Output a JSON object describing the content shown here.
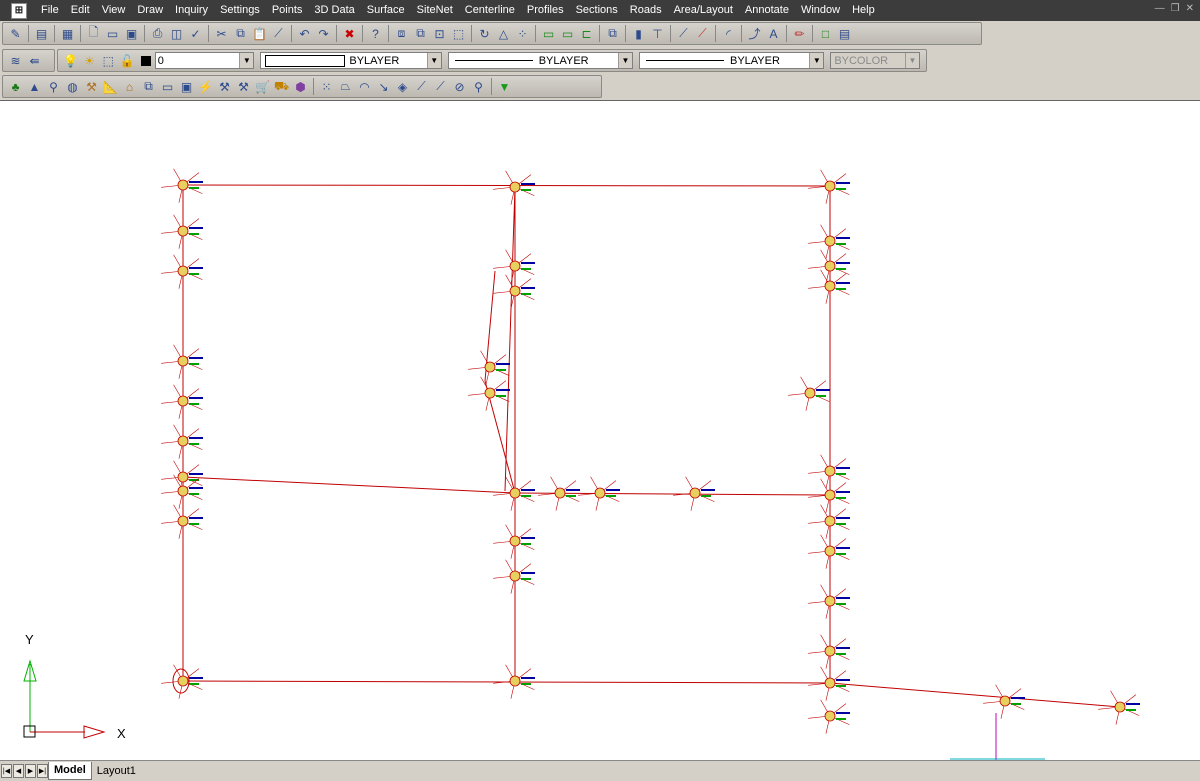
{
  "menu": [
    "File",
    "Edit",
    "View",
    "Draw",
    "Inquiry",
    "Settings",
    "Points",
    "3D Data",
    "Surface",
    "SiteNet",
    "Centerline",
    "Profiles",
    "Sections",
    "Roads",
    "Area/Layout",
    "Annotate",
    "Window",
    "Help"
  ],
  "layer": {
    "value": "0"
  },
  "linetype": {
    "value": "BYLAYER"
  },
  "lineweight": {
    "value": "BYLAYER"
  },
  "plotstyle": {
    "value": "BYLAYER"
  },
  "color": {
    "value": "BYCOLOR"
  },
  "ucs": {
    "y_label": "Y",
    "x_label": "X"
  },
  "tabs": {
    "model": "Model",
    "layout": "Layout1"
  },
  "colors": {
    "menubar": "#3c3c3c",
    "line": "#c00000",
    "point_label": "#0000a0",
    "elev_label": "#00a000"
  }
}
